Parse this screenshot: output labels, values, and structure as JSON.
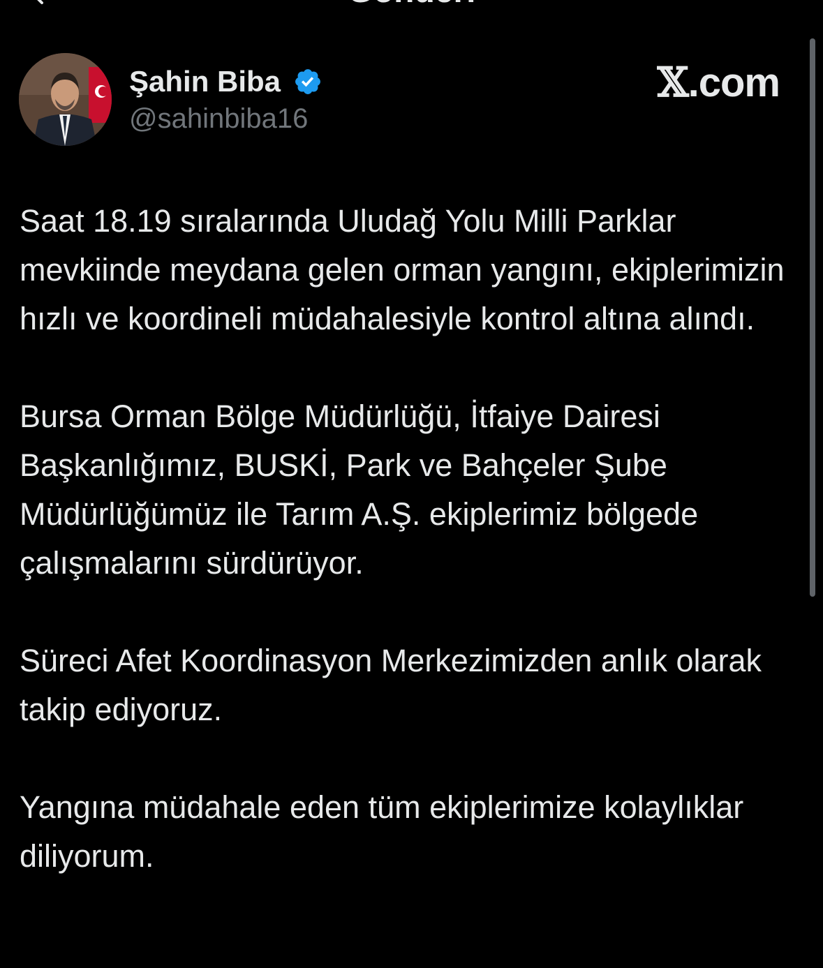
{
  "header": {
    "title": "Gönderi",
    "back_icon": "chevron-left-icon"
  },
  "author": {
    "name": "Şahin Biba",
    "handle": "@sahinbiba16",
    "verified": true,
    "verified_color": "#1d9bf0"
  },
  "brand": {
    "x_glyph": "𝕏",
    "domain_suffix": ".com"
  },
  "tweet": {
    "paragraphs": [
      "Saat 18.19 sıralarında Uludağ Yolu Milli Parklar mevkiinde meydana gelen orman yangını, ekiplerimizin hızlı ve koordineli müdahalesiyle kontrol altına alındı.",
      "Bursa Orman Bölge Müdürlüğü, İtfaiye Dairesi Başkanlığımız, BUSKİ, Park ve Bahçeler Şube Müdürlüğümüz ile Tarım A.Ş. ekiplerimiz bölgede çalışmalarını sürdürüyor.",
      "Süreci Afet Koordinasyon Merkezimizden anlık olarak takip ediyoruz.",
      "Yangına müdahale eden tüm ekiplerimize kolaylıklar diliyorum."
    ]
  },
  "colors": {
    "background": "#000000",
    "text_primary": "#e7e9ea",
    "text_secondary": "#71767b"
  }
}
